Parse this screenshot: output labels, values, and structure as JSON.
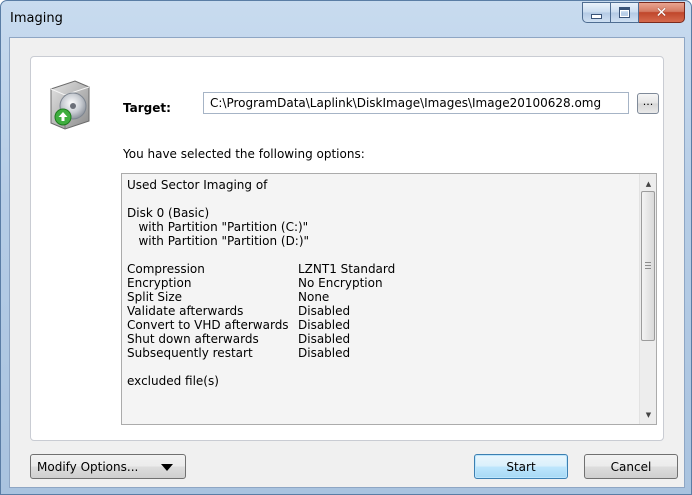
{
  "window": {
    "title": "Imaging"
  },
  "target": {
    "label": "Target:",
    "path": "C:\\ProgramData\\Laplink\\DiskImage\\Images\\Image20100628.omg",
    "browse_label": "..."
  },
  "selected_options_text": "You have selected the following options:",
  "summary": {
    "header": "Used Sector Imaging of",
    "disk": "Disk 0 (Basic)",
    "partitions": [
      "   with Partition \"Partition (C:)\"",
      "   with Partition \"Partition (D:)\""
    ],
    "settings": [
      {
        "name": "Compression",
        "value": "LZNT1 Standard"
      },
      {
        "name": "Encryption",
        "value": "No Encryption"
      },
      {
        "name": "Split Size",
        "value": "None"
      },
      {
        "name": "Validate afterwards",
        "value": "Disabled"
      },
      {
        "name": "Convert to VHD afterwards",
        "value": "Disabled"
      },
      {
        "name": "Shut down afterwards",
        "value": "Disabled"
      },
      {
        "name": "Subsequently restart",
        "value": "Disabled"
      }
    ],
    "excluded": "excluded file(s)"
  },
  "buttons": {
    "modify": "Modify Options...",
    "start": "Start",
    "cancel": "Cancel"
  },
  "colors": {
    "title_bar": "#b6cde6",
    "close_button": "#c0462b",
    "default_button": "#bee6fd"
  },
  "icons": [
    "disk-image-icon",
    "minimize-icon",
    "maximize-icon",
    "close-icon",
    "dropdown-arrow-icon",
    "scroll-up-icon",
    "scroll-down-icon"
  ]
}
